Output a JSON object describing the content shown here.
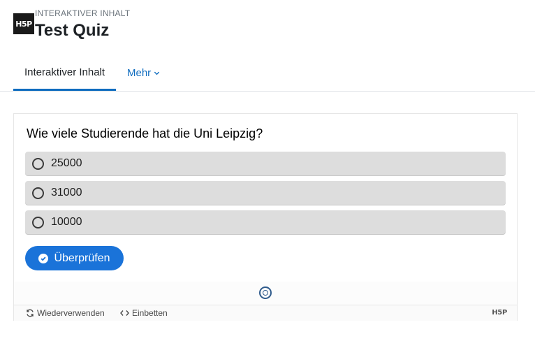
{
  "header": {
    "logo_text": "H5P",
    "pretitle": "INTERAKTIVER INHALT",
    "title": "Test Quiz"
  },
  "tabs": [
    {
      "label": "Interaktiver Inhalt",
      "active": true
    },
    {
      "label": "Mehr",
      "active": false
    }
  ],
  "quiz": {
    "question": "Wie viele Studierende hat die Uni Leipzig?",
    "options": [
      {
        "label": "25000"
      },
      {
        "label": "31000"
      },
      {
        "label": "10000"
      }
    ],
    "check_label": "Überprüfen"
  },
  "footer": {
    "reuse_label": "Wiederverwenden",
    "embed_label": "Einbetten",
    "logo_text": "H5P"
  },
  "colors": {
    "accent": "#0f6cbf",
    "button": "#1a73d9",
    "option_bg": "#dddddd"
  }
}
